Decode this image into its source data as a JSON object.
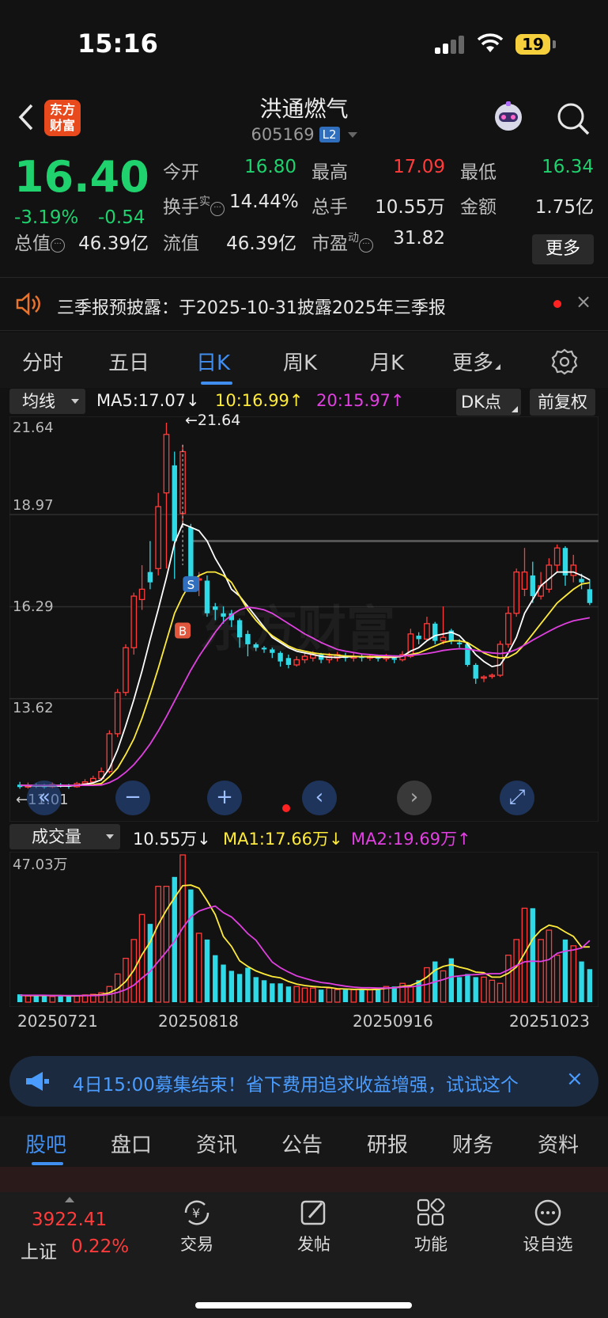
{
  "status_bar": {
    "time": "15:16",
    "battery": "19"
  },
  "header": {
    "back": "<",
    "logo_line1": "东方",
    "logo_line2": "财富",
    "title": "洪通燃气",
    "code": "605169",
    "level_badge": "L2"
  },
  "quote": {
    "price": "16.40",
    "change_pct": "-3.19%",
    "change": "-0.54",
    "open_label": "今开",
    "open": "16.80",
    "high_label": "最高",
    "high": "17.09",
    "low_label": "最低",
    "low": "16.34",
    "turnover_label": "换手",
    "turnover_sup": "实",
    "turnover": "14.44%",
    "volume_label": "总手",
    "volume": "10.55万",
    "amount_label": "金额",
    "amount": "1.75亿",
    "total_mv_label": "总值",
    "total_mv": "46.39亿",
    "float_mv_label": "流值",
    "float_mv": "46.39亿",
    "pe_label": "市盈",
    "pe_sup": "动",
    "pe": "31.82",
    "more_label": "更多",
    "colors": {
      "up": "#ff3b3b",
      "down": "#1fd26e"
    }
  },
  "notice": {
    "text": "三季报预披露：于2025-10-31披露2025年三季报",
    "close": "×"
  },
  "chart_tabs": {
    "items": [
      "分时",
      "五日",
      "日K",
      "周K",
      "月K",
      "更多"
    ],
    "active": "日K"
  },
  "ma_bar": {
    "selector": "均线",
    "ma5": "MA5:17.07↓",
    "ma10": "10:16.99↑",
    "ma20": "20:15.97↑",
    "dk": "DK点",
    "adjust": "前复权"
  },
  "kchart": {
    "y_ticks": [
      "21.64",
      "18.97",
      "16.29",
      "13.62"
    ],
    "high_annotation": "←21.64",
    "low_annotation": "←11.01",
    "sell_marker": "S",
    "buy_marker": "B",
    "watermark": "东方财富"
  },
  "volume_bar": {
    "selector": "成交量",
    "vol": "10.55万↓",
    "ma1": "MA1:17.66万↓",
    "ma2": "MA2:19.69万↑",
    "max_label": "47.03万"
  },
  "dates": [
    "20250721",
    "20250818",
    "20250916",
    "20251023"
  ],
  "chart_data": {
    "type": "candlestick",
    "y_range": [
      11.01,
      21.64
    ],
    "candles": [
      [
        11.12,
        11.05,
        11.2,
        11.0
      ],
      [
        11.05,
        11.1,
        11.18,
        11.0
      ],
      [
        11.1,
        11.08,
        11.16,
        11.02
      ],
      [
        11.08,
        11.06,
        11.14,
        11.0
      ],
      [
        11.06,
        11.12,
        11.18,
        11.02
      ],
      [
        11.12,
        11.1,
        11.16,
        11.04
      ],
      [
        11.1,
        11.06,
        11.14,
        11.0
      ],
      [
        11.06,
        11.15,
        11.2,
        11.03
      ],
      [
        11.15,
        11.2,
        11.28,
        11.1
      ],
      [
        11.2,
        11.3,
        11.38,
        11.15
      ],
      [
        11.3,
        11.5,
        11.62,
        11.25
      ],
      [
        11.5,
        12.6,
        12.7,
        11.45
      ],
      [
        12.6,
        13.8,
        13.9,
        12.5
      ],
      [
        13.8,
        15.1,
        15.2,
        13.7
      ],
      [
        15.1,
        16.6,
        16.7,
        14.9
      ],
      [
        16.5,
        16.8,
        17.5,
        16.2
      ],
      [
        17.3,
        17.0,
        18.2,
        16.8
      ],
      [
        17.4,
        19.2,
        19.6,
        17.2
      ],
      [
        19.6,
        21.3,
        21.64,
        17.4
      ],
      [
        20.4,
        18.2,
        20.8,
        17.1
      ],
      [
        19.0,
        20.8,
        21.0,
        18.6
      ],
      [
        18.6,
        17.1,
        18.7,
        17.0
      ],
      [
        17.1,
        17.1,
        17.3,
        16.6
      ],
      [
        17.05,
        16.1,
        17.2,
        16.0
      ],
      [
        16.3,
        16.2,
        16.4,
        15.9
      ],
      [
        16.1,
        16.0,
        16.3,
        15.8
      ],
      [
        16.1,
        15.9,
        16.2,
        15.7
      ],
      [
        15.9,
        15.4,
        15.95,
        15.1
      ],
      [
        15.5,
        15.2,
        15.6,
        14.85
      ],
      [
        15.2,
        15.1,
        15.25,
        15.0
      ],
      [
        15.1,
        15.05,
        15.15,
        14.95
      ],
      [
        15.05,
        14.95,
        15.1,
        14.8
      ],
      [
        14.95,
        14.7,
        15.0,
        14.55
      ],
      [
        14.8,
        14.6,
        14.9,
        14.5
      ],
      [
        14.6,
        14.75,
        14.85,
        14.55
      ],
      [
        14.75,
        14.85,
        14.95,
        14.65
      ],
      [
        14.8,
        14.9,
        15.0,
        14.7
      ],
      [
        14.9,
        14.75,
        14.95,
        14.65
      ],
      [
        14.75,
        14.85,
        14.95,
        14.65
      ],
      [
        14.8,
        14.9,
        14.98,
        14.7
      ],
      [
        14.85,
        14.8,
        14.95,
        14.7
      ],
      [
        14.8,
        14.85,
        14.95,
        14.7
      ],
      [
        14.85,
        14.8,
        14.9,
        14.7
      ],
      [
        14.8,
        14.85,
        14.92,
        14.72
      ],
      [
        14.85,
        14.78,
        14.9,
        14.7
      ],
      [
        14.78,
        14.85,
        14.92,
        14.7
      ],
      [
        14.8,
        14.75,
        14.88,
        14.65
      ],
      [
        14.75,
        14.9,
        15.0,
        14.7
      ],
      [
        14.85,
        15.5,
        15.65,
        14.8
      ],
      [
        15.45,
        15.35,
        15.55,
        15.2
      ],
      [
        15.35,
        15.8,
        16.0,
        15.3
      ],
      [
        15.8,
        15.3,
        15.85,
        15.2
      ],
      [
        15.3,
        15.4,
        16.3,
        15.2
      ],
      [
        15.6,
        15.3,
        15.65,
        15.2
      ],
      [
        15.25,
        15.2,
        15.35,
        15.1
      ],
      [
        15.2,
        14.6,
        15.25,
        14.55
      ],
      [
        14.6,
        14.2,
        14.65,
        14.05
      ],
      [
        14.25,
        14.25,
        14.3,
        14.1
      ],
      [
        14.3,
        14.3,
        14.35,
        14.2
      ],
      [
        14.3,
        15.2,
        15.3,
        14.25
      ],
      [
        15.2,
        16.1,
        16.3,
        15.1
      ],
      [
        16.1,
        17.3,
        17.4,
        16.0
      ],
      [
        16.8,
        17.3,
        18.0,
        16.6
      ],
      [
        17.2,
        16.6,
        17.6,
        16.4
      ],
      [
        16.6,
        16.9,
        17.3,
        16.5
      ],
      [
        16.8,
        17.5,
        17.7,
        16.7
      ],
      [
        17.5,
        18.0,
        18.1,
        17.3
      ],
      [
        18.0,
        17.2,
        18.05,
        16.9
      ],
      [
        17.2,
        17.5,
        17.8,
        17.0
      ],
      [
        17.1,
        17.0,
        17.25,
        16.8
      ],
      [
        16.8,
        16.4,
        17.09,
        16.34
      ]
    ],
    "ma5": [
      11.1,
      11.09,
      11.08,
      11.08,
      11.08,
      11.08,
      11.08,
      11.1,
      11.13,
      11.17,
      11.26,
      11.59,
      12.13,
      12.83,
      13.59,
      14.42,
      15.34,
      16.22,
      17.14,
      18.14,
      18.7,
      18.6,
      18.5,
      18.2,
      17.7,
      17.3,
      16.8,
      16.6,
      16.3,
      16.0,
      15.7,
      15.4,
      15.25,
      15.1,
      15.0,
      14.95,
      14.9,
      14.85,
      14.82,
      14.82,
      14.83,
      14.84,
      14.84,
      14.83,
      14.82,
      14.82,
      14.82,
      14.85,
      15.0,
      15.1,
      15.3,
      15.45,
      15.5,
      15.55,
      15.45,
      15.2,
      14.9,
      14.7,
      14.55,
      14.6,
      14.95,
      15.4,
      16.1,
      16.5,
      16.9,
      17.1,
      17.3,
      17.3,
      17.3,
      17.2,
      17.07
    ],
    "ma10": [
      11.1,
      11.1,
      11.1,
      11.1,
      11.1,
      11.1,
      11.1,
      11.1,
      11.1,
      11.12,
      11.15,
      11.35,
      11.6,
      12.0,
      12.45,
      13.05,
      13.75,
      14.5,
      15.3,
      16.1,
      16.6,
      17.0,
      17.2,
      17.3,
      17.3,
      17.2,
      17.0,
      16.6,
      16.2,
      15.9,
      15.65,
      15.45,
      15.3,
      15.15,
      15.05,
      15.0,
      14.95,
      14.92,
      14.9,
      14.88,
      14.86,
      14.85,
      14.84,
      14.84,
      14.84,
      14.84,
      14.84,
      14.86,
      14.9,
      14.95,
      15.05,
      15.15,
      15.25,
      15.3,
      15.3,
      15.25,
      15.1,
      14.95,
      14.85,
      14.8,
      14.82,
      14.95,
      15.2,
      15.5,
      15.8,
      16.1,
      16.4,
      16.6,
      16.8,
      16.95,
      16.99
    ],
    "ma20": [
      11.1,
      11.1,
      11.1,
      11.1,
      11.1,
      11.1,
      11.1,
      11.1,
      11.1,
      11.1,
      11.11,
      11.18,
      11.3,
      11.48,
      11.7,
      11.98,
      12.3,
      12.68,
      13.1,
      13.55,
      14.0,
      14.45,
      14.85,
      15.2,
      15.55,
      15.85,
      16.05,
      16.2,
      16.28,
      16.25,
      16.2,
      16.1,
      15.95,
      15.8,
      15.65,
      15.5,
      15.38,
      15.25,
      15.15,
      15.05,
      15.0,
      14.96,
      14.92,
      14.9,
      14.88,
      14.87,
      14.86,
      14.86,
      14.88,
      14.9,
      14.93,
      14.97,
      15.02,
      15.05,
      15.07,
      15.06,
      15.02,
      14.98,
      14.95,
      14.93,
      14.96,
      15.05,
      15.18,
      15.32,
      15.45,
      15.58,
      15.7,
      15.8,
      15.88,
      15.93,
      15.97
    ],
    "volume": [
      2.5,
      2.0,
      2.2,
      2.0,
      1.8,
      2.2,
      2.0,
      2.0,
      2.3,
      2.5,
      3.0,
      5.0,
      9.0,
      14.0,
      20.0,
      28.0,
      25.0,
      37.0,
      37.0,
      40.0,
      47.03,
      36.0,
      22.0,
      20.0,
      15.0,
      12.0,
      10.0,
      9.0,
      11.0,
      8.0,
      7.0,
      6.0,
      6.0,
      5.0,
      5.0,
      4.5,
      4.5,
      4.0,
      4.5,
      4.0,
      4.0,
      4.0,
      4.2,
      4.0,
      4.0,
      5.0,
      5.0,
      6.0,
      5.0,
      7.0,
      11.0,
      13.0,
      10.0,
      14.0,
      8.0,
      9.0,
      8.0,
      8.0,
      7.0,
      6.0,
      15.0,
      20.0,
      30.0,
      30.0,
      20.0,
      23.0,
      15.0,
      20.0,
      18.0,
      13.0,
      10.55
    ],
    "vol_ma1": [
      2.2,
      2.1,
      2.1,
      2.1,
      2.1,
      2.1,
      2.0,
      2.0,
      2.1,
      2.2,
      2.4,
      3.0,
      4.3,
      6.6,
      10.2,
      15.2,
      19.2,
      24.8,
      29.4,
      33.4,
      37.2,
      37.4,
      36.4,
      32.4,
      28.0,
      21.0,
      17.8,
      13.2,
      11.4,
      10.0,
      9.0,
      8.2,
      7.8,
      6.6,
      5.8,
      5.3,
      5.0,
      4.8,
      4.7,
      4.3,
      4.2,
      4.1,
      4.1,
      4.0,
      4.1,
      4.4,
      4.6,
      5.0,
      5.3,
      6.4,
      8.0,
      10.2,
      11.4,
      12.0,
      11.2,
      10.6,
      9.6,
      9.4,
      8.0,
      8.0,
      9.2,
      11.2,
      15.6,
      20.2,
      23.0,
      24.6,
      24.0,
      22.4,
      21.0,
      17.6,
      17.66
    ],
    "vol_ma2": [
      2.2,
      2.2,
      2.2,
      2.2,
      2.1,
      2.1,
      2.1,
      2.1,
      2.1,
      2.1,
      2.2,
      2.5,
      3.1,
      4.0,
      5.4,
      7.7,
      9.8,
      13.0,
      16.1,
      19.5,
      23.7,
      27.2,
      29.1,
      30.0,
      30.7,
      28.6,
      27.2,
      24.7,
      21.9,
      19.8,
      16.2,
      12.8,
      11.0,
      9.6,
      8.4,
      7.6,
      6.9,
      6.3,
      6.0,
      5.5,
      5.1,
      4.8,
      4.6,
      4.6,
      4.5,
      4.5,
      4.6,
      4.8,
      4.9,
      5.2,
      5.7,
      6.5,
      7.2,
      8.1,
      8.4,
      8.7,
      8.8,
      9.0,
      9.1,
      9.1,
      10.3,
      11.7,
      12.9,
      13.1,
      13.0,
      13.6,
      15.6,
      16.3,
      16.7,
      17.3,
      19.69
    ]
  },
  "promo": {
    "text": "4日15:00募集结束！省下费用追求收益增强，试试这个",
    "close": "×"
  },
  "bottom_tabs": {
    "items": [
      "股吧",
      "盘口",
      "资讯",
      "公告",
      "研报",
      "财务",
      "资料"
    ],
    "active": "股吧"
  },
  "bottom_nav": {
    "index_value": "3922.41",
    "index_name": "上证",
    "index_pct": "0.22%",
    "trade": "交易",
    "post": "发帖",
    "func": "功能",
    "watch": "设自选"
  }
}
